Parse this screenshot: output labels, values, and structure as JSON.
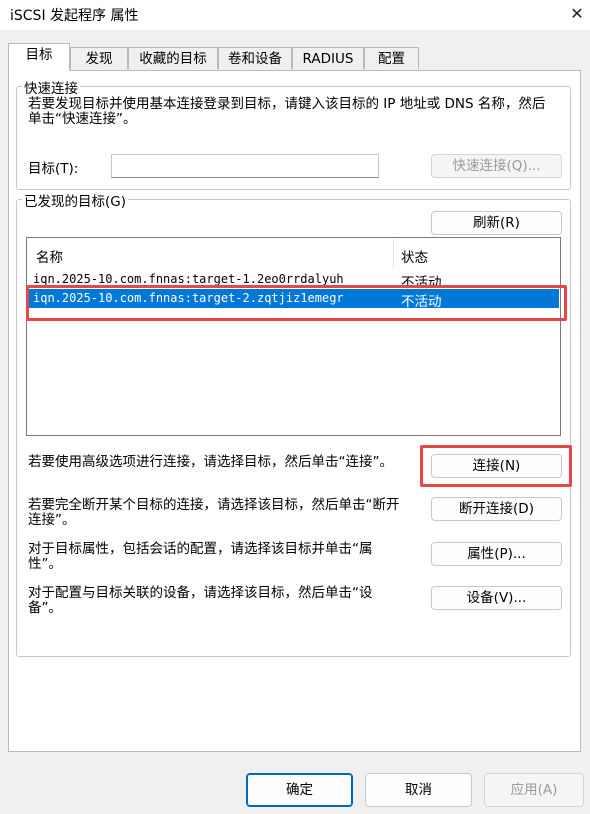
{
  "window": {
    "title": "iSCSI 发起程序 属性",
    "close_glyph": "✕"
  },
  "tabs": [
    "目标",
    "发现",
    "收藏的目标",
    "卷和设备",
    "RADIUS",
    "配置"
  ],
  "quick_connect": {
    "legend": "快速连接",
    "description": "若要发现目标并使用基本连接登录到目标，请键入该目标的 IP 地址或 DNS 名称，然后单击“快速连接”。",
    "target_label": "目标(T):",
    "target_value": "",
    "button": "快速连接(Q)..."
  },
  "discovered": {
    "legend": "已发现的目标(G)",
    "refresh_button": "刷新(R)",
    "columns": [
      "名称",
      "状态"
    ],
    "rows": [
      {
        "name": "iqn.2025-10.com.fnnas:target-1.2eo0rrdalyuh",
        "status": "不活动"
      },
      {
        "name": "iqn.2025-10.com.fnnas:target-2.zqtjiz1emegr",
        "status": "不活动"
      }
    ]
  },
  "actions": [
    {
      "text": "若要使用高级选项进行连接，请选择目标，然后单击“连接”。",
      "button": "连接(N)"
    },
    {
      "text": "若要完全断开某个目标的连接，请选择该目标，然后单击“断开连接”。",
      "button": "断开连接(D)"
    },
    {
      "text": "对于目标属性，包括会话的配置，请选择该目标并单击“属性”。",
      "button": "属性(P)..."
    },
    {
      "text": "对于配置与目标关联的设备，请选择该目标，然后单击“设备”。",
      "button": "设备(V)..."
    }
  ],
  "footer": {
    "ok": "确定",
    "cancel": "取消",
    "apply": "应用(A)"
  },
  "colors": {
    "selection": "#0078d7",
    "highlight_box": "#e64848",
    "primary_border": "#0067c0"
  }
}
